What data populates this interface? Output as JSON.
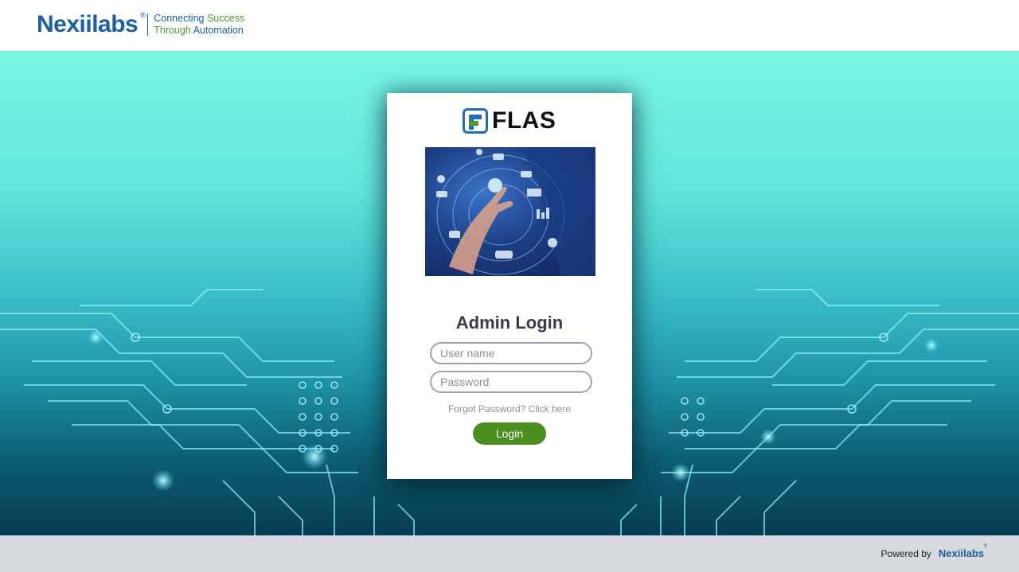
{
  "header": {
    "brand_name": "Nexiilabs",
    "registered_mark": "®",
    "tagline_line1_prefix": "Connecting",
    "tagline_line1_accent": "Success",
    "tagline_line2_prefix": "Through",
    "tagline_line2_accent": "Automation"
  },
  "login": {
    "app_name": "FLAS",
    "title": "Admin Login",
    "username_placeholder": "User name",
    "password_placeholder": "Password",
    "forgot_link": "Forgot Password? Click here",
    "login_button": "Login"
  },
  "footer": {
    "powered_by": "Powered by",
    "brand": "Nexiilabs"
  },
  "colors": {
    "brand_blue": "#1a5ea6",
    "brand_green": "#4b9b2e",
    "login_button": "#4a8f1f",
    "footer_bg": "#d6d9de"
  },
  "icons": {
    "app_logo": "flas-logo-icon",
    "hero_image": "digital-hand-network-illustration"
  }
}
